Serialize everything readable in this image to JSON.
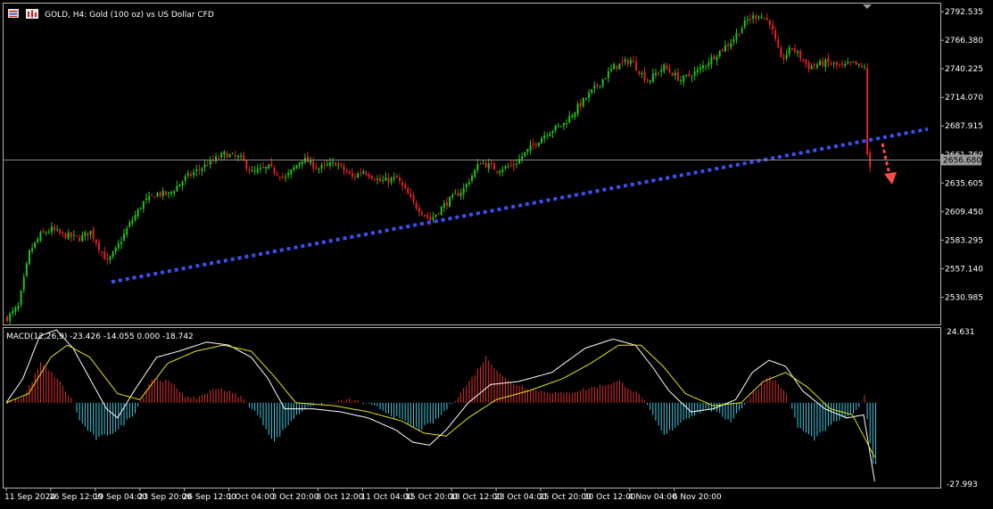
{
  "header": {
    "title": "GOLD, H4:  Gold (100 oz) vs US Dollar CFD"
  },
  "macd": {
    "label": "MACD(12,26,9) -23.426 -14.055 0.000 -18.742"
  },
  "colors": {
    "background": "#000000",
    "bull_candle": "#26c11b",
    "bear_candle": "#e12323",
    "trendline": "#3c50f0",
    "arrow": "#ff4a4a",
    "macd_line": "#ffffff",
    "signal_line": "#e6e619",
    "hist_pos": "#e03030",
    "hist_neg": "#3fc8e0",
    "price_badge": "#9a9a9a"
  },
  "chart_data": {
    "type": "candlestick",
    "symbol": "GOLD",
    "timeframe": "H4",
    "price_axis": {
      "ylim": [
        2506,
        2800
      ],
      "ticks": [
        "2792.535",
        "2766.380",
        "2740.225",
        "2714.070",
        "2687.915",
        "2661.760",
        "2635.605",
        "2609.450",
        "2583.295",
        "2557.140",
        "2530.985"
      ],
      "current_price": "2656.680"
    },
    "x_axis": {
      "labels": [
        "11 Sep 2024",
        "16 Sep 12:00",
        "19 Sep 04:00",
        "23 Sep 20:00",
        "26 Sep 12:00",
        "1 Oct 04:00",
        "3 Oct 20:00",
        "8 Oct 12:00",
        "11 Oct 04:00",
        "15 Oct 20:00",
        "18 Oct 12:00",
        "23 Oct 04:00",
        "25 Oct 20:00",
        "30 Oct 12:00",
        "4 Nov 04:00",
        "6 Nov 20:00"
      ],
      "bars_per_label": 16
    },
    "close_path": [
      [
        0,
        2512
      ],
      [
        4,
        2522
      ],
      [
        8,
        2572
      ],
      [
        12,
        2588
      ],
      [
        16,
        2593
      ],
      [
        20,
        2588
      ],
      [
        26,
        2585
      ],
      [
        30,
        2591
      ],
      [
        36,
        2563
      ],
      [
        39,
        2574
      ],
      [
        44,
        2598
      ],
      [
        49,
        2618
      ],
      [
        54,
        2626
      ],
      [
        58,
        2625
      ],
      [
        64,
        2640
      ],
      [
        72,
        2653
      ],
      [
        78,
        2662
      ],
      [
        84,
        2658
      ],
      [
        88,
        2645
      ],
      [
        94,
        2650
      ],
      [
        100,
        2640
      ],
      [
        106,
        2658
      ],
      [
        112,
        2649
      ],
      [
        118,
        2654
      ],
      [
        124,
        2641
      ],
      [
        128,
        2647
      ],
      [
        134,
        2637
      ],
      [
        140,
        2640
      ],
      [
        146,
        2617
      ],
      [
        152,
        2602
      ],
      [
        158,
        2618
      ],
      [
        164,
        2630
      ],
      [
        170,
        2655
      ],
      [
        176,
        2648
      ],
      [
        182,
        2652
      ],
      [
        188,
        2668
      ],
      [
        194,
        2682
      ],
      [
        200,
        2690
      ],
      [
        206,
        2708
      ],
      [
        212,
        2725
      ],
      [
        218,
        2742
      ],
      [
        224,
        2748
      ],
      [
        230,
        2729
      ],
      [
        236,
        2742
      ],
      [
        242,
        2730
      ],
      [
        248,
        2738
      ],
      [
        254,
        2752
      ],
      [
        260,
        2765
      ],
      [
        266,
        2785
      ],
      [
        270,
        2790
      ],
      [
        274,
        2783
      ],
      [
        278,
        2748
      ],
      [
        282,
        2760
      ],
      [
        288,
        2742
      ],
      [
        294,
        2746
      ],
      [
        300,
        2742
      ],
      [
        304,
        2745
      ],
      [
        308,
        2740
      ],
      [
        310,
        2650
      ]
    ],
    "trendline": {
      "start": [
        "19 Sep",
        2545
      ],
      "end": [
        "6 Nov",
        2685
      ],
      "style": "dotted"
    },
    "forecast_arrow": {
      "from": 2663,
      "to": 2636,
      "direction": "down"
    },
    "macd": {
      "params": [
        12,
        26,
        9
      ],
      "ylim": [
        -27.993,
        24.631
      ],
      "ticks": [
        "24.631",
        "-27.993"
      ],
      "hist_path": [
        [
          0,
          0
        ],
        [
          6,
          2
        ],
        [
          12,
          13
        ],
        [
          18,
          8
        ],
        [
          24,
          0
        ],
        [
          26,
          -6
        ],
        [
          32,
          -12
        ],
        [
          40,
          -9
        ],
        [
          46,
          -3
        ],
        [
          52,
          8
        ],
        [
          58,
          7
        ],
        [
          66,
          1
        ],
        [
          76,
          5
        ],
        [
          84,
          2
        ],
        [
          90,
          -4
        ],
        [
          96,
          -13
        ],
        [
          102,
          -6
        ],
        [
          108,
          -1
        ],
        [
          116,
          0
        ],
        [
          124,
          1
        ],
        [
          134,
          -2
        ],
        [
          142,
          -6
        ],
        [
          148,
          -9
        ],
        [
          154,
          -6
        ],
        [
          160,
          0
        ],
        [
          166,
          7
        ],
        [
          172,
          15
        ],
        [
          180,
          7
        ],
        [
          190,
          4
        ],
        [
          200,
          3
        ],
        [
          210,
          5
        ],
        [
          220,
          7
        ],
        [
          228,
          2
        ],
        [
          236,
          -11
        ],
        [
          244,
          -5
        ],
        [
          252,
          -2
        ],
        [
          260,
          -6
        ],
        [
          268,
          3
        ],
        [
          274,
          9
        ],
        [
          280,
          3
        ],
        [
          284,
          -8
        ],
        [
          290,
          -12
        ],
        [
          298,
          -6
        ],
        [
          304,
          -4
        ],
        [
          308,
          2
        ],
        [
          311,
          -20
        ]
      ],
      "macd_path": [
        [
          0,
          0
        ],
        [
          6,
          8
        ],
        [
          12,
          22
        ],
        [
          18,
          24
        ],
        [
          24,
          18
        ],
        [
          30,
          8
        ],
        [
          36,
          -2
        ],
        [
          40,
          -5
        ],
        [
          46,
          4
        ],
        [
          54,
          15
        ],
        [
          62,
          17
        ],
        [
          72,
          20
        ],
        [
          80,
          19
        ],
        [
          88,
          15
        ],
        [
          94,
          8
        ],
        [
          100,
          -2
        ],
        [
          110,
          -2
        ],
        [
          120,
          -3
        ],
        [
          130,
          -5
        ],
        [
          140,
          -9
        ],
        [
          146,
          -13
        ],
        [
          152,
          -14
        ],
        [
          158,
          -9
        ],
        [
          166,
          0
        ],
        [
          174,
          6
        ],
        [
          184,
          7
        ],
        [
          196,
          10
        ],
        [
          208,
          18
        ],
        [
          218,
          21
        ],
        [
          226,
          19
        ],
        [
          232,
          12
        ],
        [
          238,
          4
        ],
        [
          246,
          -3
        ],
        [
          254,
          -2
        ],
        [
          262,
          1
        ],
        [
          268,
          10
        ],
        [
          274,
          14
        ],
        [
          280,
          12
        ],
        [
          286,
          4
        ],
        [
          294,
          -2
        ],
        [
          302,
          -5
        ],
        [
          308,
          -4
        ],
        [
          312,
          -26
        ]
      ],
      "signal_path": [
        [
          0,
          0
        ],
        [
          8,
          3
        ],
        [
          16,
          15
        ],
        [
          22,
          19
        ],
        [
          30,
          15
        ],
        [
          40,
          3
        ],
        [
          48,
          1
        ],
        [
          58,
          13
        ],
        [
          68,
          17
        ],
        [
          78,
          19
        ],
        [
          88,
          17
        ],
        [
          96,
          9
        ],
        [
          104,
          0
        ],
        [
          118,
          -1
        ],
        [
          130,
          -3
        ],
        [
          142,
          -6
        ],
        [
          150,
          -10
        ],
        [
          158,
          -11
        ],
        [
          166,
          -5
        ],
        [
          176,
          1
        ],
        [
          188,
          4
        ],
        [
          200,
          8
        ],
        [
          210,
          13
        ],
        [
          220,
          19
        ],
        [
          228,
          19
        ],
        [
          236,
          12
        ],
        [
          244,
          3
        ],
        [
          254,
          -1
        ],
        [
          264,
          0
        ],
        [
          272,
          7
        ],
        [
          280,
          10
        ],
        [
          288,
          5
        ],
        [
          296,
          -2
        ],
        [
          304,
          -4
        ],
        [
          312,
          -18
        ]
      ]
    }
  }
}
